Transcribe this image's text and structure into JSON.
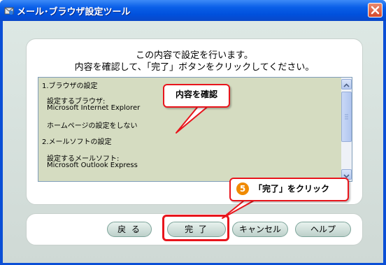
{
  "window": {
    "title": "メール･ブラウザ設定ツール",
    "close_label": "✕"
  },
  "message": {
    "line1": "この内容で設定を行います。",
    "line2": "内容を確認して、「完了」ボタンをクリックしてください。"
  },
  "summary_lines": [
    "1.ブラウザの設定",
    "設定するブラウザ:",
    "Microsoft Internet Explorer",
    "ホームページの設定をしない",
    "2.メールソフトの設定",
    "設定するメールソフト:",
    "Microsoft Outlook Express"
  ],
  "buttons": {
    "back": "戻 る",
    "finish": "完 了",
    "cancel": "キャンセル",
    "help": "ヘルプ"
  },
  "annotations": {
    "confirm_callout": "内容を確認",
    "step_number": "5",
    "step_callout": "「完了」をクリック"
  },
  "colors": {
    "titlebar": "#0a5fe8",
    "highlight": "#e8151c",
    "textbox_bg": "#d5dcc1",
    "step_badge": "#f08a00"
  }
}
